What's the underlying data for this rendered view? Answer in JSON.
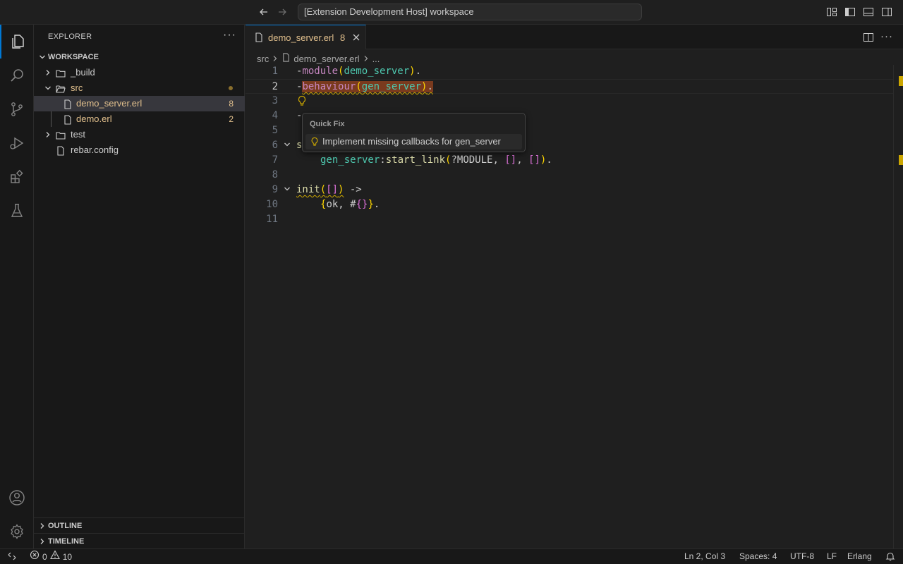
{
  "titlebar": {
    "command_center": "[Extension Development Host] workspace"
  },
  "sidebar": {
    "title": "EXPLORER",
    "more": "···",
    "workspace_label": "WORKSPACE",
    "tree": [
      {
        "label": "_build",
        "type": "folder",
        "expanded": false
      },
      {
        "label": "src",
        "type": "folder",
        "expanded": true
      },
      {
        "label": "demo_server.erl",
        "type": "file",
        "badge": "8"
      },
      {
        "label": "demo.erl",
        "type": "file",
        "badge": "2"
      },
      {
        "label": "test",
        "type": "folder",
        "expanded": false
      },
      {
        "label": "rebar.config",
        "type": "file"
      }
    ],
    "outline_label": "OUTLINE",
    "timeline_label": "TIMELINE"
  },
  "editor": {
    "tab": {
      "label": "demo_server.erl",
      "problem_count": "8"
    },
    "breadcrumbs": {
      "folder": "src",
      "file": "demo_server.erl",
      "more": "..."
    },
    "line_numbers": [
      "1",
      "2",
      "3",
      "4",
      "5",
      "6",
      "7",
      "8",
      "9",
      "10",
      "11"
    ],
    "code": {
      "l1_dash": "-",
      "l1_kw": "module",
      "l1_open": "(",
      "l1_atom": "demo_server",
      "l1_close": ")",
      "l1_end": ".",
      "l2_dash": "-",
      "l2_kw": "behaviour",
      "l2_open": "(",
      "l2_atom": "gen_server",
      "l2_close": ")",
      "l2_end": ".",
      "l4_dash": "-",
      "l6_start": "s",
      "l7_mod": "gen_server",
      "l7_colon": ":",
      "l7_fn": "start_link",
      "l7_open": "(",
      "l7_arg": "?MODULE, ",
      "l7_b1": "[]",
      "l7_comma": ", ",
      "l7_b2": "[]",
      "l7_close": ")",
      "l7_end": ".",
      "l9_fn": "init",
      "l9_open": "(",
      "l9_arg": "[]",
      "l9_close": ")",
      "l9_arrow": " ->",
      "l10_open": "{",
      "l10_ok": "ok, #",
      "l10_map": "{}",
      "l10_close": "}",
      "l10_end": "."
    },
    "quick_fix": {
      "title": "Quick Fix",
      "action": "Implement missing callbacks for gen_server"
    }
  },
  "statusbar": {
    "errors": "0",
    "warnings": "10",
    "position": "Ln 2, Col 3",
    "spaces": "Spaces: 4",
    "encoding": "UTF-8",
    "eol": "LF",
    "language": "Erlang"
  },
  "colors": {
    "accent": "#0078d4",
    "modified": "#e2c08d",
    "warning": "#cca700"
  }
}
